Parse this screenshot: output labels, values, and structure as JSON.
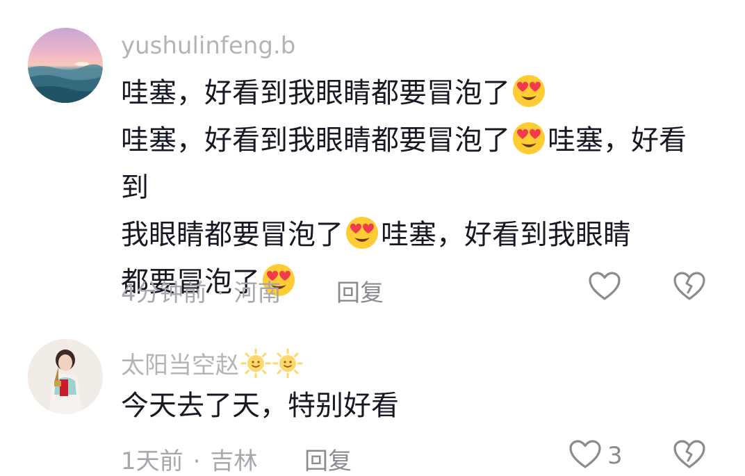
{
  "comments": [
    {
      "username": "yushulinfeng.b",
      "segments": [
        "哇塞，好看到我眼睛都要冒泡了",
        "哇塞，好看到我眼睛都要冒泡了",
        "哇塞，好看到",
        "我眼睛都要冒泡了",
        "哇塞，好看到我眼睛",
        "都要冒泡了"
      ],
      "emoji": "heart-eyes-emoji",
      "time": "4分钟前",
      "location": "河南",
      "reply_label": "回复",
      "like_count": ""
    },
    {
      "username": "太阳当空赵",
      "badges": [
        "sun-badge",
        "sun-badge"
      ],
      "text": "今天去了天，特别好看",
      "time": "1天前",
      "location": "吉林",
      "reply_label": "回复",
      "like_count": "3"
    }
  ],
  "separator": "·",
  "icons": {
    "like": "heart-outline-icon",
    "dislike": "broken-heart-icon"
  },
  "colors": {
    "username": "#b3b3b8",
    "body": "#161823",
    "meta": "#a7a7ad",
    "icon": "#8a8a90"
  }
}
